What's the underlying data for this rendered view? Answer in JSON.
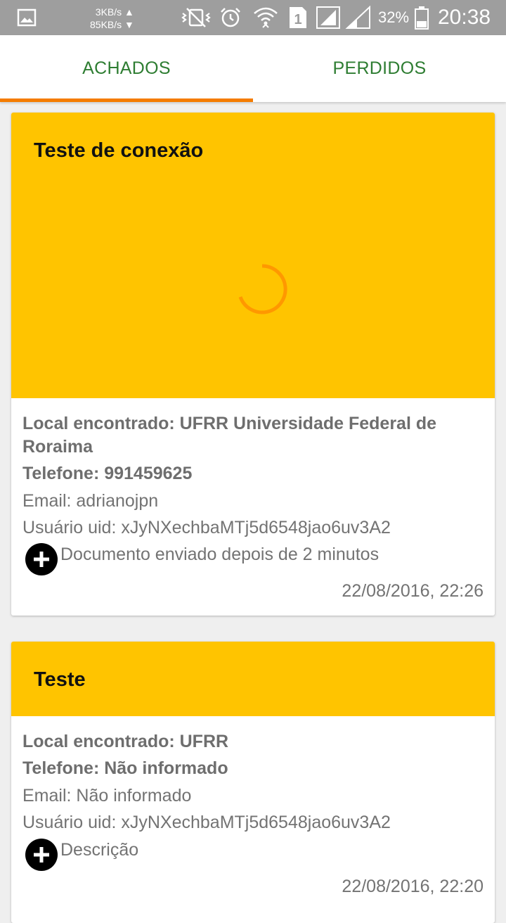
{
  "status_bar": {
    "upload_speed": "3KB/s ▲",
    "download_speed": "85KB/s ▼",
    "sim_slot": "1",
    "battery": "32%",
    "time": "20:38",
    "icons": [
      "gallery-icon",
      "vibrate-icon",
      "alarm-icon",
      "wifi-icon",
      "sim-icon",
      "signal-icon",
      "battery-icon"
    ]
  },
  "tabs": [
    {
      "label": "ACHADOS",
      "selected": true
    },
    {
      "label": "PERDIDOS",
      "selected": false
    }
  ],
  "colors": {
    "accent": "#f57c00",
    "tab_text": "#2e7d32",
    "card_header": "#ffc400",
    "spinner": "#ff9800"
  },
  "cards": [
    {
      "title": "Teste de conexão",
      "image_loading": true,
      "local": "Local encontrado: UFRR Universidade Federal de Roraima",
      "telefone": "Telefone: 991459625",
      "email": "Email: adrianojpn",
      "usuario": "Usuário uid: xJyNXechbaMTj5d6548jao6uv3A2",
      "descricao": "Documento enviado depois de 2 minutos",
      "data": "22/08/2016, 22:26"
    },
    {
      "title": "Teste",
      "image_loading": false,
      "local": "Local encontrado: UFRR",
      "telefone": "Telefone: Não informado",
      "email": "Email: Não informado",
      "usuario": "Usuário uid: xJyNXechbaMTj5d6548jao6uv3A2",
      "descricao": "Descrição",
      "data": "22/08/2016, 22:20"
    }
  ]
}
